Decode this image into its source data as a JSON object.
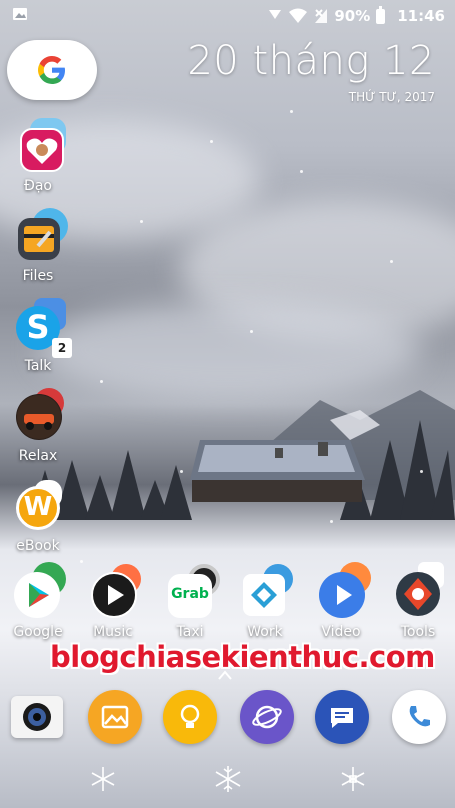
{
  "status_bar": {
    "battery_percent": "90%",
    "time": "11:46",
    "icons": [
      "image-icon",
      "signal-icon",
      "wifi-icon",
      "no-sim-icon",
      "battery-icon"
    ]
  },
  "search_widget": {
    "letter": "G",
    "icon": "google-icon"
  },
  "clock_widget": {
    "date": "20 tháng 12",
    "weekday_year": "THỨ TƯ, 2017"
  },
  "folders": [
    {
      "label": "Đạo"
    },
    {
      "label": "Files"
    },
    {
      "label": "Talk",
      "badge": "2"
    },
    {
      "label": "Relax"
    },
    {
      "label": "eBook"
    }
  ],
  "apps": [
    {
      "label": "Google"
    },
    {
      "label": "Music"
    },
    {
      "label": "Taxi",
      "grab_text": "Grab"
    },
    {
      "label": "Work"
    },
    {
      "label": "Video"
    },
    {
      "label": "Tools"
    }
  ],
  "watermark": "blogchiasekienthuc.com",
  "dock": [
    "camera-icon",
    "gallery-icon",
    "tips-icon",
    "internet-icon",
    "messages-icon",
    "phone-icon"
  ],
  "navigation": [
    "snowflake-left-icon",
    "snowflake-home-icon",
    "snowflake-right-icon"
  ],
  "colors": {
    "watermark": "#e0192e",
    "gallery": "#f6a623",
    "tips": "#f9b90a",
    "internet": "#6a55c9",
    "messages": "#2b54b8",
    "video": "#3b7de8"
  }
}
